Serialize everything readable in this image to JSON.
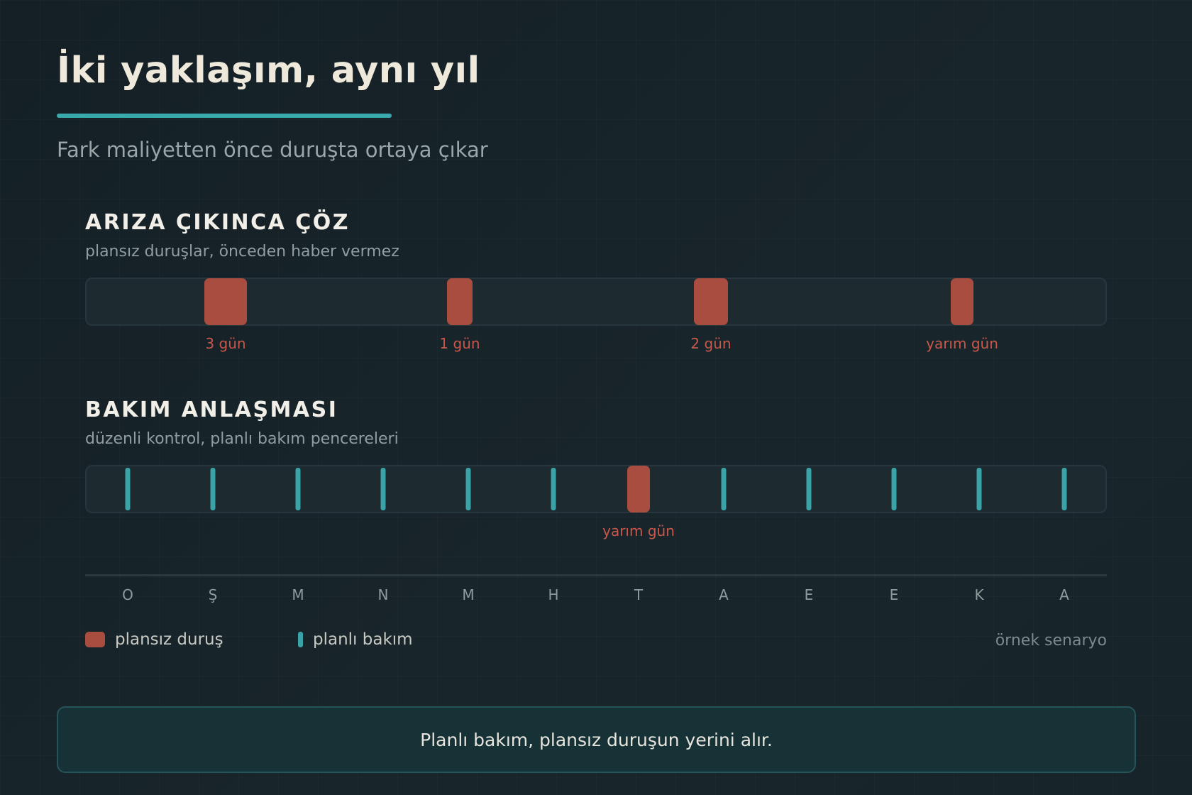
{
  "header": {
    "title": "İki yaklaşım, aynı yıl",
    "subtitle": "Fark maliyetten önce duruşta ortaya çıkar"
  },
  "colors": {
    "downtime": "#a84d40",
    "downtime_label": "#c9584a",
    "maintenance": "#3aa3a8",
    "accent": "#3aa9ad"
  },
  "chart_data": {
    "type": "timeline",
    "months": [
      "O",
      "Ş",
      "M",
      "N",
      "M",
      "H",
      "T",
      "A",
      "E",
      "E",
      "K",
      "A"
    ],
    "month_range": [
      0,
      12
    ],
    "rows": [
      {
        "title": "ARIZA ÇIKINCA ÇÖZ",
        "subtitle": "plansız duruşlar, önceden haber vermez",
        "downtime": [
          {
            "month_pos": 1.65,
            "days": 3,
            "label": "3 gün"
          },
          {
            "month_pos": 4.4,
            "days": 1,
            "label": "1 gün"
          },
          {
            "month_pos": 7.35,
            "days": 2,
            "label": "2 gün"
          },
          {
            "month_pos": 10.3,
            "days": 0.5,
            "label": "yarım gün"
          }
        ],
        "maintenance": []
      },
      {
        "title": "BAKIM ANLAŞMASI",
        "subtitle": "düzenli kontrol, planlı bakım pencereleri",
        "downtime": [
          {
            "month_pos": 6.5,
            "days": 0.5,
            "label": "yarım gün"
          }
        ],
        "maintenance": [
          0.5,
          1.5,
          2.5,
          3.5,
          4.5,
          5.5,
          7.5,
          8.5,
          9.5,
          10.5,
          11.5
        ]
      }
    ],
    "legend": {
      "downtime": "plansız duruş",
      "maintenance": "planlı bakım"
    },
    "note": "örnek senaryo"
  },
  "callout": "Planlı bakım, plansız duruşun yerini alır."
}
